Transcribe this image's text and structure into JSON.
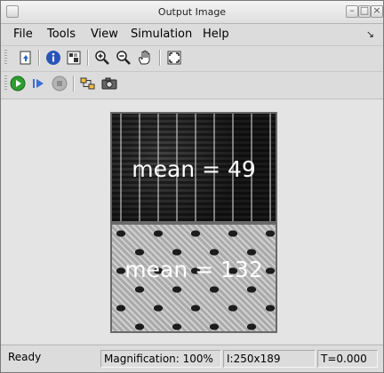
{
  "window": {
    "title": "Output Image"
  },
  "menubar": {
    "items": [
      {
        "label": "File"
      },
      {
        "label": "Tools"
      },
      {
        "label": "View"
      },
      {
        "label": "Simulation"
      },
      {
        "label": "Help"
      }
    ]
  },
  "toolbar1": {
    "icons": [
      "open-block-icon",
      "info-icon",
      "pixel-region-icon",
      "zoom-in-icon",
      "zoom-out-icon",
      "pan-hand-icon",
      "fit-to-window-icon"
    ]
  },
  "toolbar2": {
    "icons": [
      "run-icon",
      "step-forward-icon",
      "stop-icon",
      "signal-highlight-icon",
      "snapshot-camera-icon"
    ]
  },
  "image": {
    "top_label": "mean = 49",
    "bottom_label": "mean = 132"
  },
  "statusbar": {
    "status": "Ready",
    "magnification": "Magnification: 100%",
    "image_size": "I:250x189",
    "time": "T=0.000"
  },
  "colors": {
    "run_green": "#2e9e2e",
    "step_blue": "#3a6fd8",
    "stop_gray": "#8c8c8c"
  }
}
